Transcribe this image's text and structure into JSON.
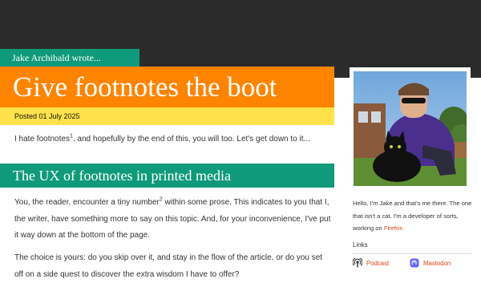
{
  "header": {
    "site_title": "Jake Archibald wrote..."
  },
  "article": {
    "title": "Give footnotes the boot",
    "posted": "Posted 01 July 2025",
    "intro": {
      "before": "I hate footnotes",
      "sup": "1",
      "after": ", and hopefully by the end of this, you will too. Let's get down to it..."
    },
    "section_heading": "The UX of footnotes in printed media",
    "para1": {
      "before": "You, the reader, encounter a tiny number",
      "sup": "2",
      "after": " within some prose. This indicates to you that I, the writer, have something more to say on this topic. And, for your inconvenience, I've put it way down at the bottom of the page."
    },
    "para2": "The choice is yours: do you skip over it, and stay in the flow of the article, or do you set off on a side quest to discover the extra wisdom I have to offer?"
  },
  "sidebar": {
    "bio": {
      "before": "Hello, I'm Jake and that's me there. The one that isn't a cat. I'm a developer of sorts, working on ",
      "link": "Firefox",
      "after": "."
    },
    "links_label": "Links",
    "links": [
      {
        "label": "Podcast",
        "icon": "podcast-icon"
      },
      {
        "label": "Mastodon",
        "icon": "mastodon-icon"
      }
    ]
  },
  "colors": {
    "header_bg": "#2b2b2b",
    "teal": "#0f9a7b",
    "orange": "#ff8400",
    "yellow": "#ffe24b",
    "link": "#e0441c",
    "mastodon_purple": "#6364ff"
  }
}
